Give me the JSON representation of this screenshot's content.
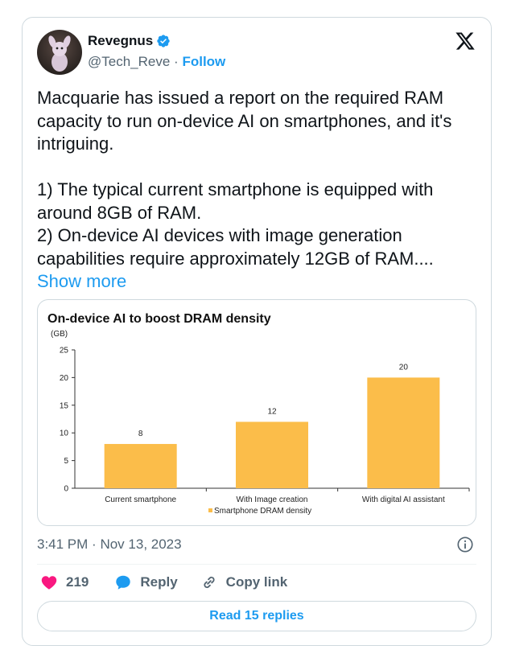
{
  "author": {
    "name": "Revegnus",
    "handle": "@Tech_Reve",
    "separator": "·",
    "follow_label": "Follow"
  },
  "tweet": {
    "text": "Macquarie has issued a report on the required RAM capacity to run on-device AI on smartphones, and it's intriguing.\n\n1) The typical current smartphone is equipped with around 8GB of RAM.\n2) On-device AI devices with image generation capabilities require approximately 12GB of RAM....",
    "show_more_label": "Show more"
  },
  "chart_data": {
    "type": "bar",
    "title": "On-device AI to boost DRAM density",
    "ylabel": "(GB)",
    "categories": [
      "Current smartphone",
      "With Image creation",
      "With digital AI assistant"
    ],
    "series": [
      {
        "name": "Smartphone DRAM density",
        "values": [
          8,
          12,
          20
        ]
      }
    ],
    "ylim": [
      0,
      25
    ],
    "yticks": [
      0,
      5,
      10,
      15,
      20,
      25
    ],
    "grid": false,
    "legend": "bottom-center",
    "bar_color": "#fbbd4a"
  },
  "meta": {
    "time": "3:41 PM",
    "separator": "·",
    "date": "Nov 13, 2023"
  },
  "actions": {
    "likes": "219",
    "reply_label": "Reply",
    "copy_link_label": "Copy link"
  },
  "read_replies_label": "Read 15 replies",
  "colors": {
    "accent": "#1d9bf0",
    "like": "#f91880",
    "text_secondary": "#536471"
  }
}
